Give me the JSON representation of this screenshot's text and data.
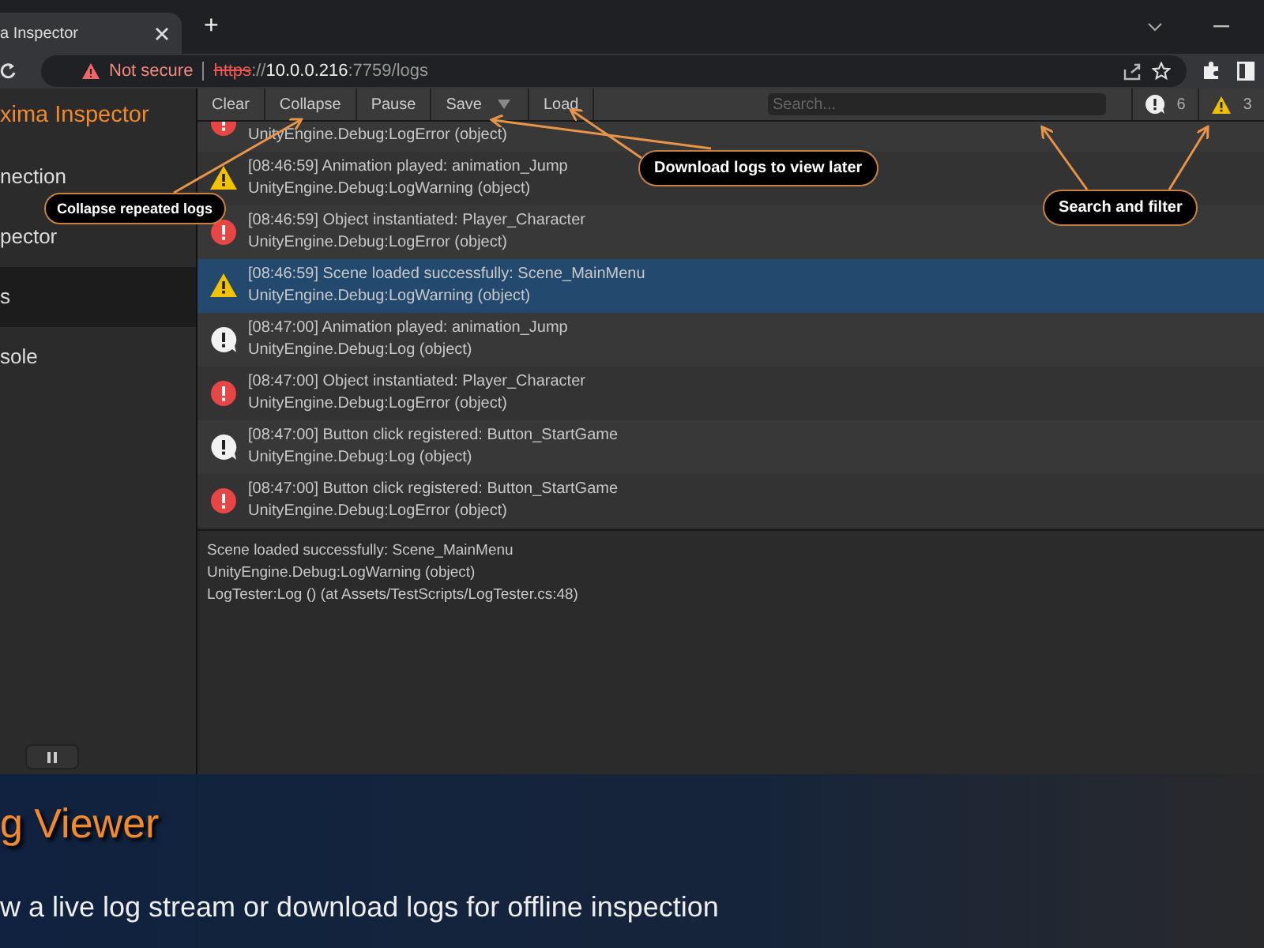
{
  "browser": {
    "tab_title": "a Inspector",
    "new_tab": "+",
    "security": "Not secure",
    "url": {
      "scheme": "https",
      "rest": "://",
      "host": "10.0.0.216",
      "path": ":7759/logs"
    }
  },
  "sidebar": {
    "title": "xima Inspector",
    "items": [
      {
        "label": "nection",
        "selected": false
      },
      {
        "label": "pector",
        "selected": false
      },
      {
        "label": "s",
        "selected": true
      },
      {
        "label": "sole",
        "selected": false
      }
    ]
  },
  "toolbar": {
    "buttons": [
      {
        "label": "Clear",
        "kind": "plain"
      },
      {
        "label": "Collapse",
        "kind": "plain"
      },
      {
        "label": "Pause",
        "kind": "plain"
      },
      {
        "label": "Save",
        "kind": "dropdown"
      },
      {
        "label": "Load",
        "kind": "plain"
      }
    ],
    "search": {
      "placeholder": "Search..."
    },
    "counters": [
      {
        "kind": "log",
        "count": "6"
      },
      {
        "kind": "warning",
        "count": "3"
      }
    ]
  },
  "logs": [
    {
      "kind": "error",
      "source": "UnityEngine.Debug:LogError (object)",
      "selected": false
    },
    {
      "kind": "warning",
      "message": "[08:46:59] Animation played: animation_Jump",
      "source": "UnityEngine.Debug:LogWarning (object)",
      "selected": false
    },
    {
      "kind": "error",
      "message": "[08:46:59] Object instantiated: Player_Character",
      "source": "UnityEngine.Debug:LogError (object)",
      "selected": false
    },
    {
      "kind": "warning",
      "message": "[08:46:59] Scene loaded successfully: Scene_MainMenu",
      "source": "UnityEngine.Debug:LogWarning (object)",
      "selected": true
    },
    {
      "kind": "log",
      "message": "[08:47:00] Animation played: animation_Jump",
      "source": "UnityEngine.Debug:Log (object)",
      "selected": false
    },
    {
      "kind": "error",
      "message": "[08:47:00] Object instantiated: Player_Character",
      "source": "UnityEngine.Debug:LogError (object)",
      "selected": false
    },
    {
      "kind": "log",
      "message": "[08:47:00] Button click registered: Button_StartGame",
      "source": "UnityEngine.Debug:Log (object)",
      "selected": false
    },
    {
      "kind": "error",
      "message": "[08:47:00] Button click registered: Button_StartGame",
      "source": "UnityEngine.Debug:LogError (object)",
      "selected": false
    }
  ],
  "detail": [
    "Scene loaded successfully: Scene_MainMenu",
    "UnityEngine.Debug:LogWarning (object)",
    "LogTester:Log () (at Assets/TestScripts/LogTester.cs:48)"
  ],
  "callouts": [
    "Collapse repeated logs",
    "Download logs to view later",
    "Search and filter"
  ],
  "banner": {
    "title": "g Viewer",
    "subtitle": "w a live log stream or download logs for offline inspection"
  }
}
